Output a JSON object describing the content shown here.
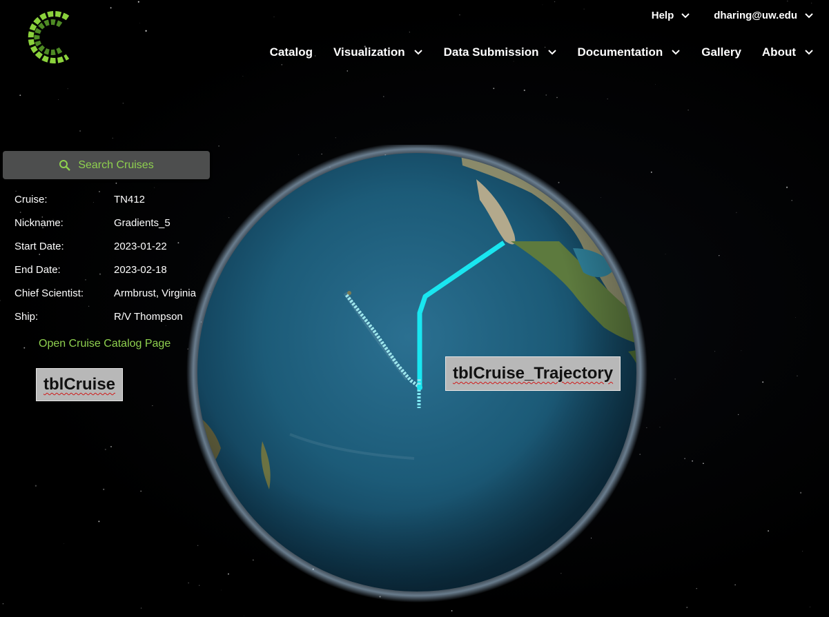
{
  "header": {
    "logo_icon": "cmap-logo-icon",
    "top_nav": [
      {
        "label": "Help"
      },
      {
        "label": "dharing@uw.edu"
      }
    ],
    "main_nav": [
      {
        "label": "Catalog",
        "dropdown": false
      },
      {
        "label": "Visualization",
        "dropdown": true
      },
      {
        "label": "Data Submission",
        "dropdown": true
      },
      {
        "label": "Documentation",
        "dropdown": true
      },
      {
        "label": "Gallery",
        "dropdown": false
      },
      {
        "label": "About",
        "dropdown": true
      }
    ]
  },
  "sidebar": {
    "search_icon": "search-icon",
    "search_label": "Search Cruises",
    "cruise_info": [
      {
        "label": "Cruise:",
        "value": "TN412"
      },
      {
        "label": "Nickname:",
        "value": "Gradients_5"
      },
      {
        "label": "Start Date:",
        "value": "2023-01-22"
      },
      {
        "label": "End Date:",
        "value": "2023-02-18"
      },
      {
        "label": "Chief Scientist:",
        "value": "Armbrust, Virginia"
      },
      {
        "label": "Ship:",
        "value": "R/V Thompson"
      }
    ],
    "catalog_link": "Open Cruise Catalog Page"
  },
  "annotations": {
    "left": "tblCruise",
    "right": "tblCruise_Trajectory"
  },
  "colors": {
    "accent_green": "#8fd14f",
    "trajectory": "#19e6f0",
    "ocean": "#1f5f7a",
    "panel_bg": "#4d4e4e"
  }
}
